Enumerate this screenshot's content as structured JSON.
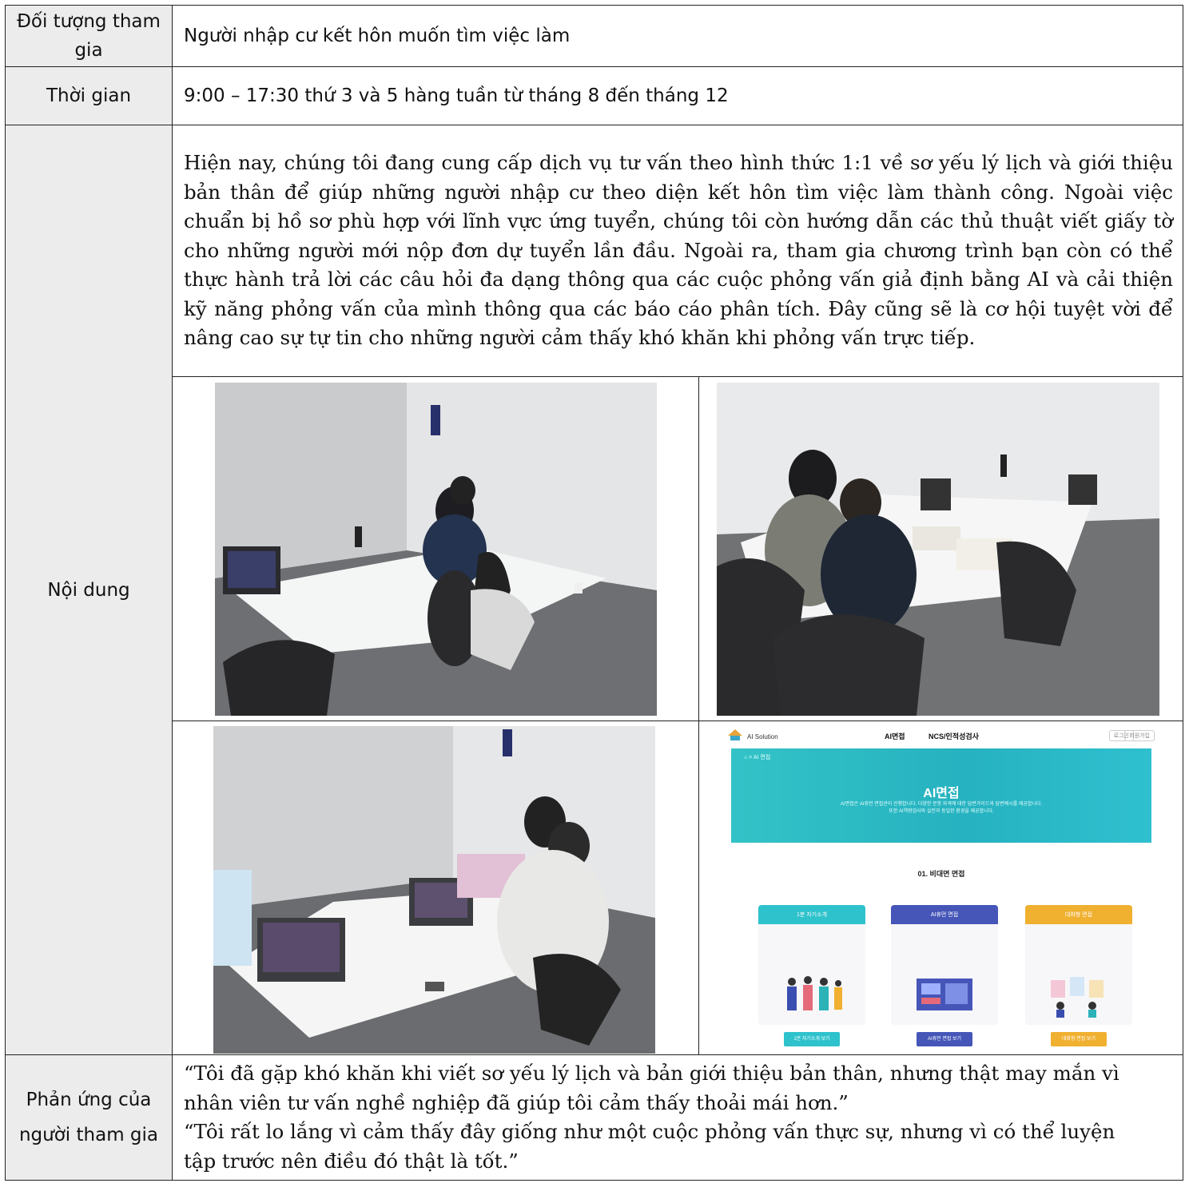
{
  "rows": {
    "target": {
      "label": "Đối tượng tham gia",
      "value": "Người nhập cư kết hôn muốn tìm việc làm"
    },
    "time": {
      "label": "Thời gian",
      "value": "9:00 – 17:30 thứ 3 và 5 hàng tuần từ tháng 8 đến tháng 12"
    },
    "content": {
      "label": "Nội dung",
      "paragraph": "Hiện nay, chúng tôi đang cung cấp dịch vụ tư vấn theo hình thức 1:1 về sơ yếu lý lịch và giới thiệu bản thân để giúp những người nhập cư theo diện kết hôn tìm việc làm thành công. Ngoài việc chuẩn bị hồ sơ phù hợp với lĩnh vực ứng tuyển, chúng tôi còn hướng dẫn các thủ thuật viết giấy tờ cho những người mới nộp đơn dự tuyển lần đầu. Ngoài ra, tham gia chương trình bạn còn có thể thực hành trả lời các câu hỏi đa dạng thông qua các cuộc phỏng vấn giả định bằng AI và cải thiện kỹ năng phỏng vấn của mình thông qua các báo cáo phân tích. Đây cũng sẽ là cơ hội tuyệt vời để nâng cao sự tự tin cho những người cảm thấy khó khăn khi phỏng vấn trực tiếp."
    },
    "feedback": {
      "label": "Phản ứng của người tham gia",
      "quote1": "“Tôi đã gặp khó khăn khi viết sơ yếu lý lịch và bản giới thiệu bản thân, nhưng thật may mắn vì nhân viên tư vấn nghề nghiệp đã giúp tôi cảm thấy thoải mái hơn.”",
      "quote2": "“Tôi rất lo lắng vì cảm thấy đây giống như một cuộc phỏng vấn thực sự, nhưng vì có thể luyện tập trước nên điều đó thật là tốt.”"
    }
  },
  "screenshot": {
    "brand": "AI Solution",
    "nav": [
      "AI면접",
      "NCS/인적성검사"
    ],
    "buttons": [
      "로그인",
      "회원가입"
    ],
    "breadcrumb": "⌂ > AI 면접",
    "hero_title": "AI면접",
    "hero_sub1": "AI면접은 AI휴먼 면접관이 진행합니다. 다양한 문항 자격에 대한 답변가이드와 답변예시를 제공합니다.",
    "hero_sub2": "또한 AI역량검사와 실전과 동일한 환경을 제공합니다.",
    "section": "01. 비대면 면접",
    "cards": [
      {
        "title": "1분 자기소개",
        "button": "1분 자기소개 보기",
        "color": "#2ec2cc"
      },
      {
        "title": "AI휴먼 면접",
        "button": "AI휴먼 면접 보기",
        "color": "#4556b8"
      },
      {
        "title": "대화형 면접",
        "button": "대화형 면접 보기",
        "color": "#f0b030"
      }
    ]
  }
}
